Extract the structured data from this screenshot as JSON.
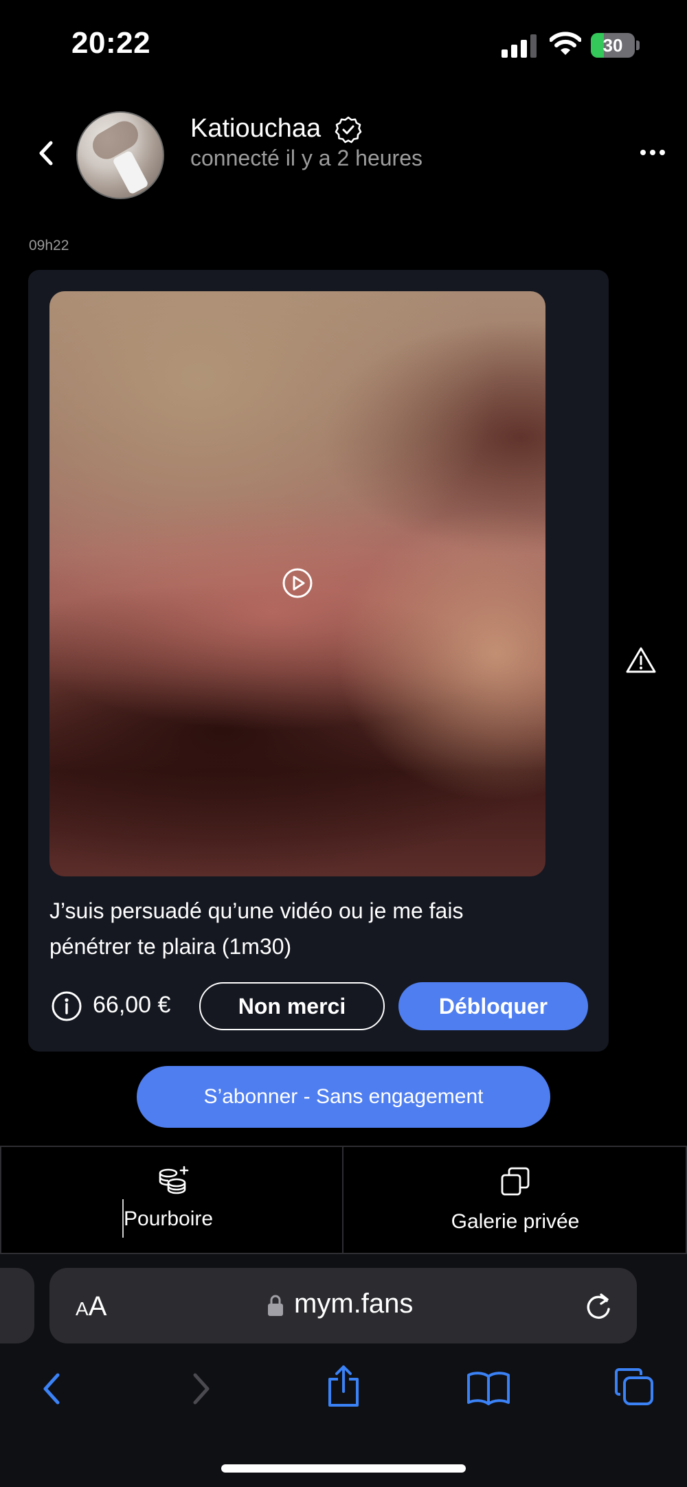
{
  "status_bar": {
    "time": "20:22",
    "battery_percent": "30",
    "battery_level": 0.3,
    "signal_icon": "cellular-signal-icon",
    "wifi_icon": "wifi-icon",
    "battery_icon": "battery-charging-icon"
  },
  "header": {
    "back_icon": "chevron-left-icon",
    "username": "Katiouchaa",
    "verified_icon": "verified-badge-icon",
    "presence": "connecté il y a 2 heures",
    "more_icon": "more-horizontal-icon"
  },
  "message": {
    "time": "09h22",
    "caption": "J’suis persuadé qu’une vidéo ou je me fais pénétrer te plaira (1m30)",
    "price": "66,00 €",
    "decline_label": "Non merci",
    "unlock_label": "Débloquer",
    "play_icon": "play-circle-icon",
    "info_icon": "info-icon",
    "warning_icon": "warning-triangle-icon"
  },
  "subscribe_label": "S’abonner - Sans engagement",
  "bottom_tabs": [
    {
      "label": "Pourboire",
      "icon": "coins-plus-icon"
    },
    {
      "label": "Galerie privée",
      "icon": "copy-stack-icon"
    }
  ],
  "browser": {
    "text_size_label_small": "A",
    "text_size_label_large": "A",
    "url": "mym.fans",
    "lock_icon": "lock-icon",
    "reload_icon": "reload-icon",
    "nav_icons": [
      "back-arrow-icon",
      "forward-arrow-icon",
      "share-icon",
      "bookmarks-icon",
      "tabs-icon"
    ]
  },
  "colors": {
    "accent": "#4f7ef0",
    "background": "#000000",
    "card": "#151821",
    "muted_text": "#9d9d9d",
    "battery_green": "#34c759",
    "ios_blue": "#3b82f6"
  }
}
